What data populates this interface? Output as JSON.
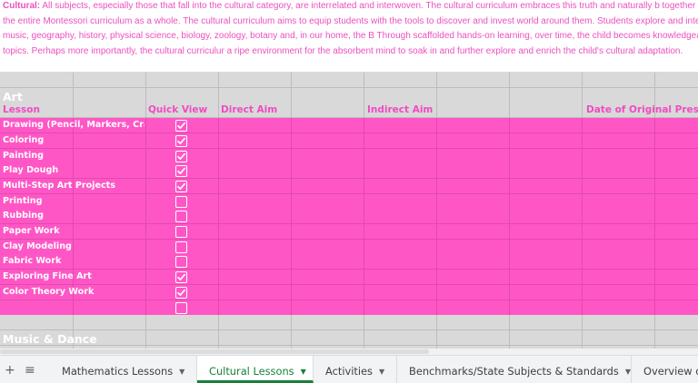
{
  "intro": {
    "label": "Cultural:",
    "text": " All subjects, especially those that fall into the cultural category, are interrelated and interwoven. The cultural curriculum embraces this truth and naturally b together not only these subjects but the entire Montessori curriculum as a whole. The cultural curriculum aims to equip students with the tools to discover and invest world around them. Students explore and interact with fine arts, dance, music, geography, history, physical science, biology, zoology, botany and, in our home, the B Through scaffolded hands-on learning, over time, the child becomes knowledgeable and can speak to these topics. Perhaps more importantly, the cultural curriculur a ripe environment for the absorbent mind to soak in and further explore and enrich the child's cultural adaptation."
  },
  "sheet": {
    "section_art": "Art",
    "headers": {
      "lesson": "Lesson",
      "quick_view": "Quick View",
      "direct_aim": "Direct Aim",
      "indirect_aim": "Indirect Aim",
      "date": "Date of Original Prese"
    },
    "lessons": [
      {
        "name": "Drawing (Pencil, Markers, Crayons)",
        "checked": true
      },
      {
        "name": "Coloring",
        "checked": true
      },
      {
        "name": "Painting",
        "checked": true
      },
      {
        "name": "Play Dough",
        "checked": true
      },
      {
        "name": "Multi-Step Art Projects",
        "checked": true
      },
      {
        "name": "Printing",
        "checked": false
      },
      {
        "name": "Rubbing",
        "checked": false
      },
      {
        "name": "Paper Work",
        "checked": false
      },
      {
        "name": "Clay Modeling",
        "checked": false
      },
      {
        "name": "Fabric Work",
        "checked": false
      },
      {
        "name": "Exploring Fine Art",
        "checked": true
      },
      {
        "name": "Color Theory Work",
        "checked": true
      },
      {
        "name": "",
        "checked": false
      }
    ],
    "section_music": "Music & Dance"
  },
  "tabbar": {
    "add_icon": "plus-icon",
    "all_sheets_icon": "list-icon",
    "tabs": [
      {
        "label": "Mathematics Lessons",
        "active": false
      },
      {
        "label": "Cultural Lessons",
        "active": true
      },
      {
        "label": "Activities",
        "active": false
      },
      {
        "label": "Benchmarks/State Subjects & Standards",
        "active": false
      },
      {
        "label": "Overview o",
        "active": false
      }
    ]
  },
  "colors": {
    "accent_pink": "#ff56c6",
    "text_pink": "#ec4fbe",
    "active_tab": "#188038"
  }
}
